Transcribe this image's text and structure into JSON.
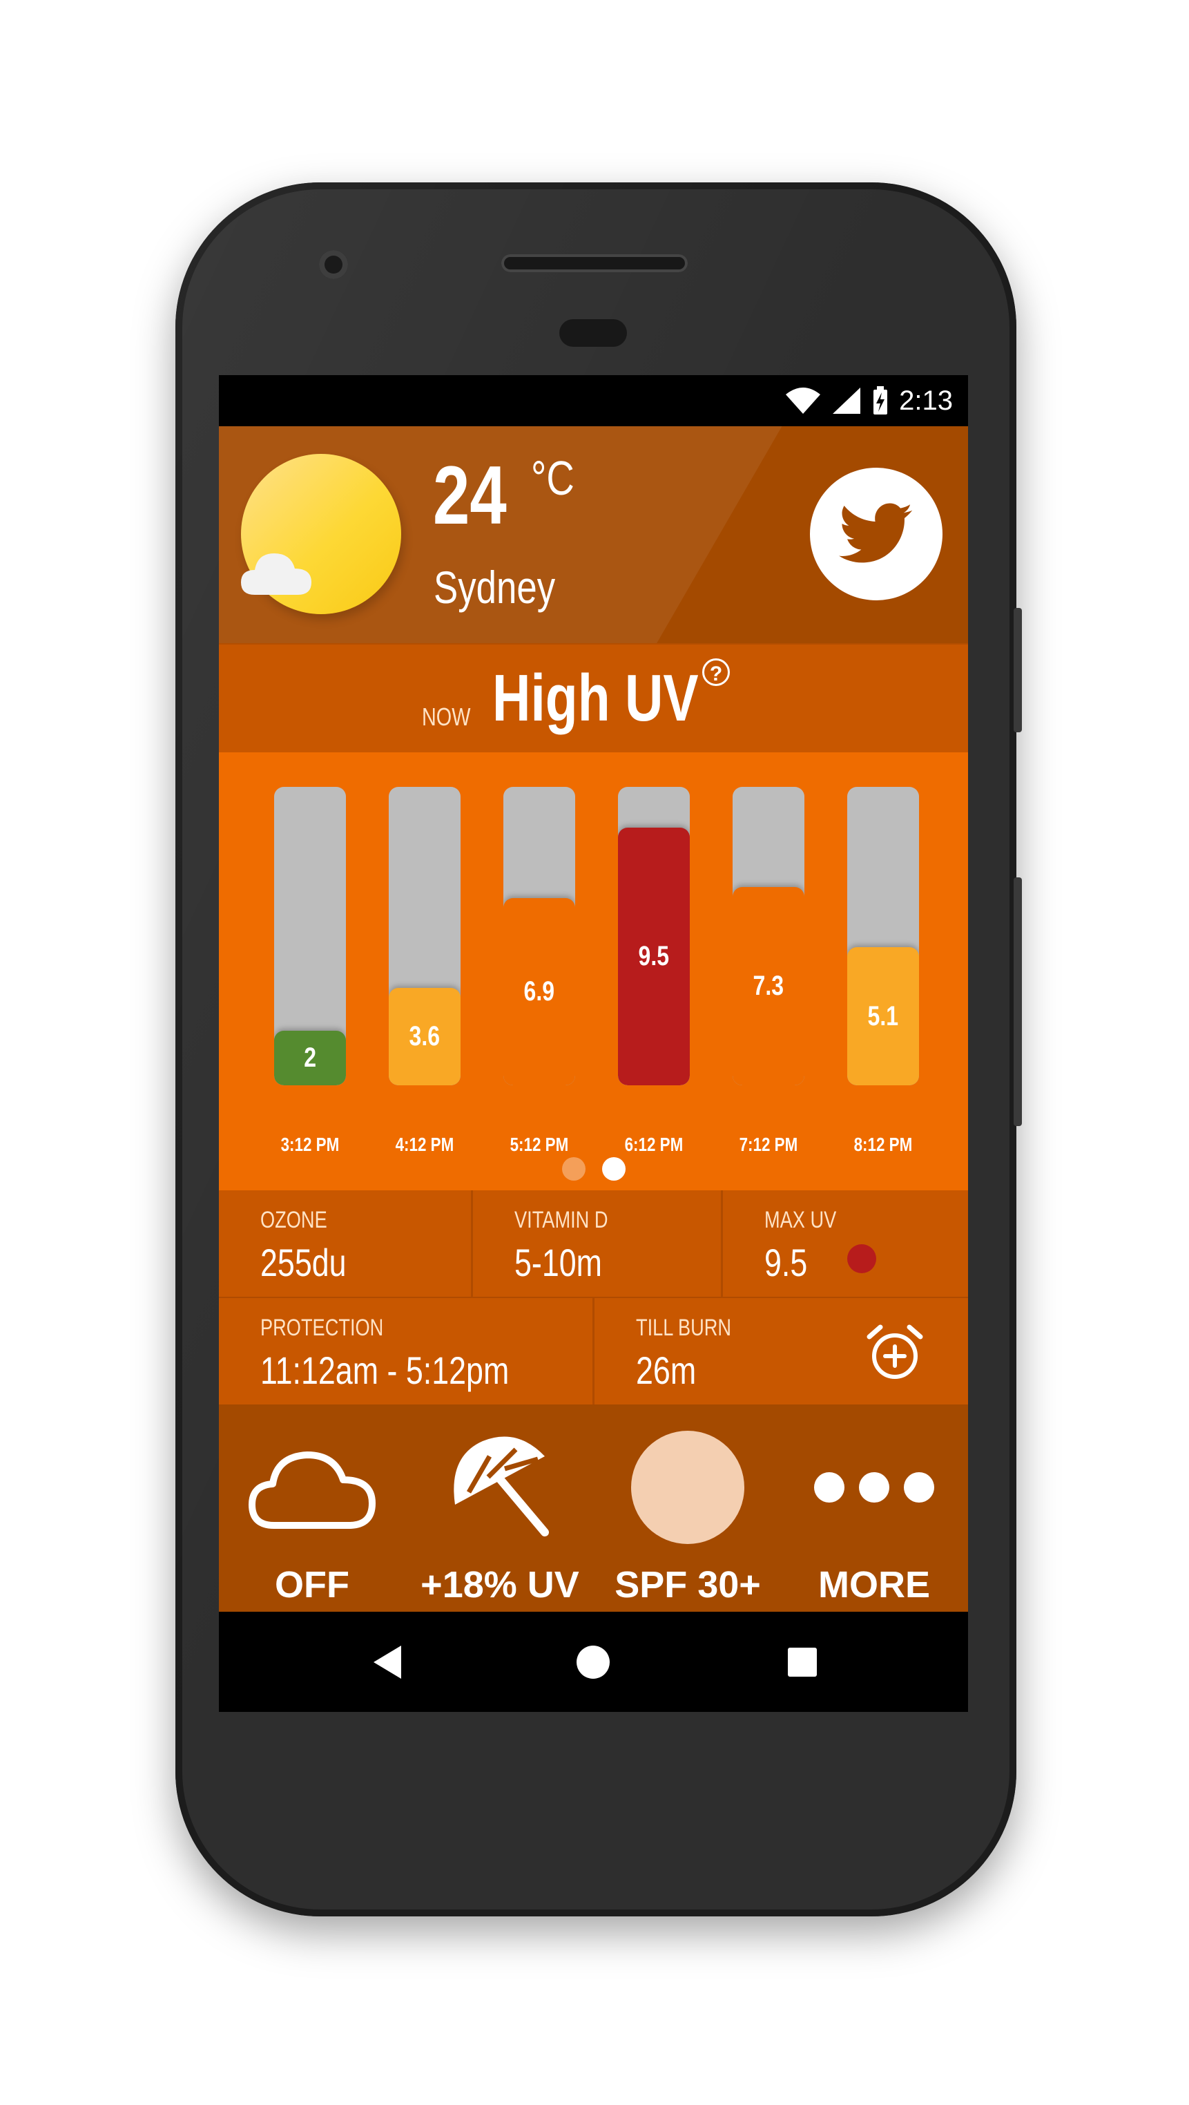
{
  "status_bar": {
    "time": "2:13"
  },
  "weather": {
    "temperature": "24",
    "unit": "°C",
    "city": "Sydney"
  },
  "uv_banner": {
    "prefix": "NOW",
    "level": "High UV",
    "help": "?"
  },
  "forecast": {
    "bars": [
      {
        "value": 2,
        "label": "2",
        "time": "3:12 PM",
        "color": "#558b2f"
      },
      {
        "value": 3.6,
        "label": "3.6",
        "time": "4:12 PM",
        "color": "#f9a825"
      },
      {
        "value": 6.9,
        "label": "6.9",
        "time": "5:12 PM",
        "color": "#ef6c00"
      },
      {
        "value": 9.5,
        "label": "9.5",
        "time": "6:12 PM",
        "color": "#b71c1c"
      },
      {
        "value": 7.3,
        "label": "7.3",
        "time": "7:12 PM",
        "color": "#ef6c00"
      },
      {
        "value": 5.1,
        "label": "5.1",
        "time": "8:12 PM",
        "color": "#f9a825"
      }
    ],
    "max_scale": 11,
    "pages": 2,
    "active_page": 2
  },
  "info": {
    "ozone": {
      "label": "OZONE",
      "value": "255du"
    },
    "vitamin": {
      "label": "VITAMIN D",
      "value": "5-10m"
    },
    "max_uv": {
      "label": "MAX UV",
      "value": "9.5",
      "dot_color": "#b71c1c"
    },
    "protection": {
      "label": "PROTECTION",
      "value": "11:12am - 5:12pm"
    },
    "till_burn": {
      "label": "TILL BURN",
      "value": "26m"
    }
  },
  "actions": [
    {
      "icon": "cloud-icon",
      "label": "OFF"
    },
    {
      "icon": "umbrella-icon",
      "label": "+18% UV"
    },
    {
      "icon": "skin-tone-icon",
      "label": "SPF 30+",
      "color": "#f4cfb1"
    },
    {
      "icon": "more-icon",
      "label": "MORE"
    }
  ],
  "colors": {
    "header": "#a44a00",
    "banner": "#c85700",
    "forecast_bg": "#ef6c00",
    "track": "#bdbdbd"
  }
}
